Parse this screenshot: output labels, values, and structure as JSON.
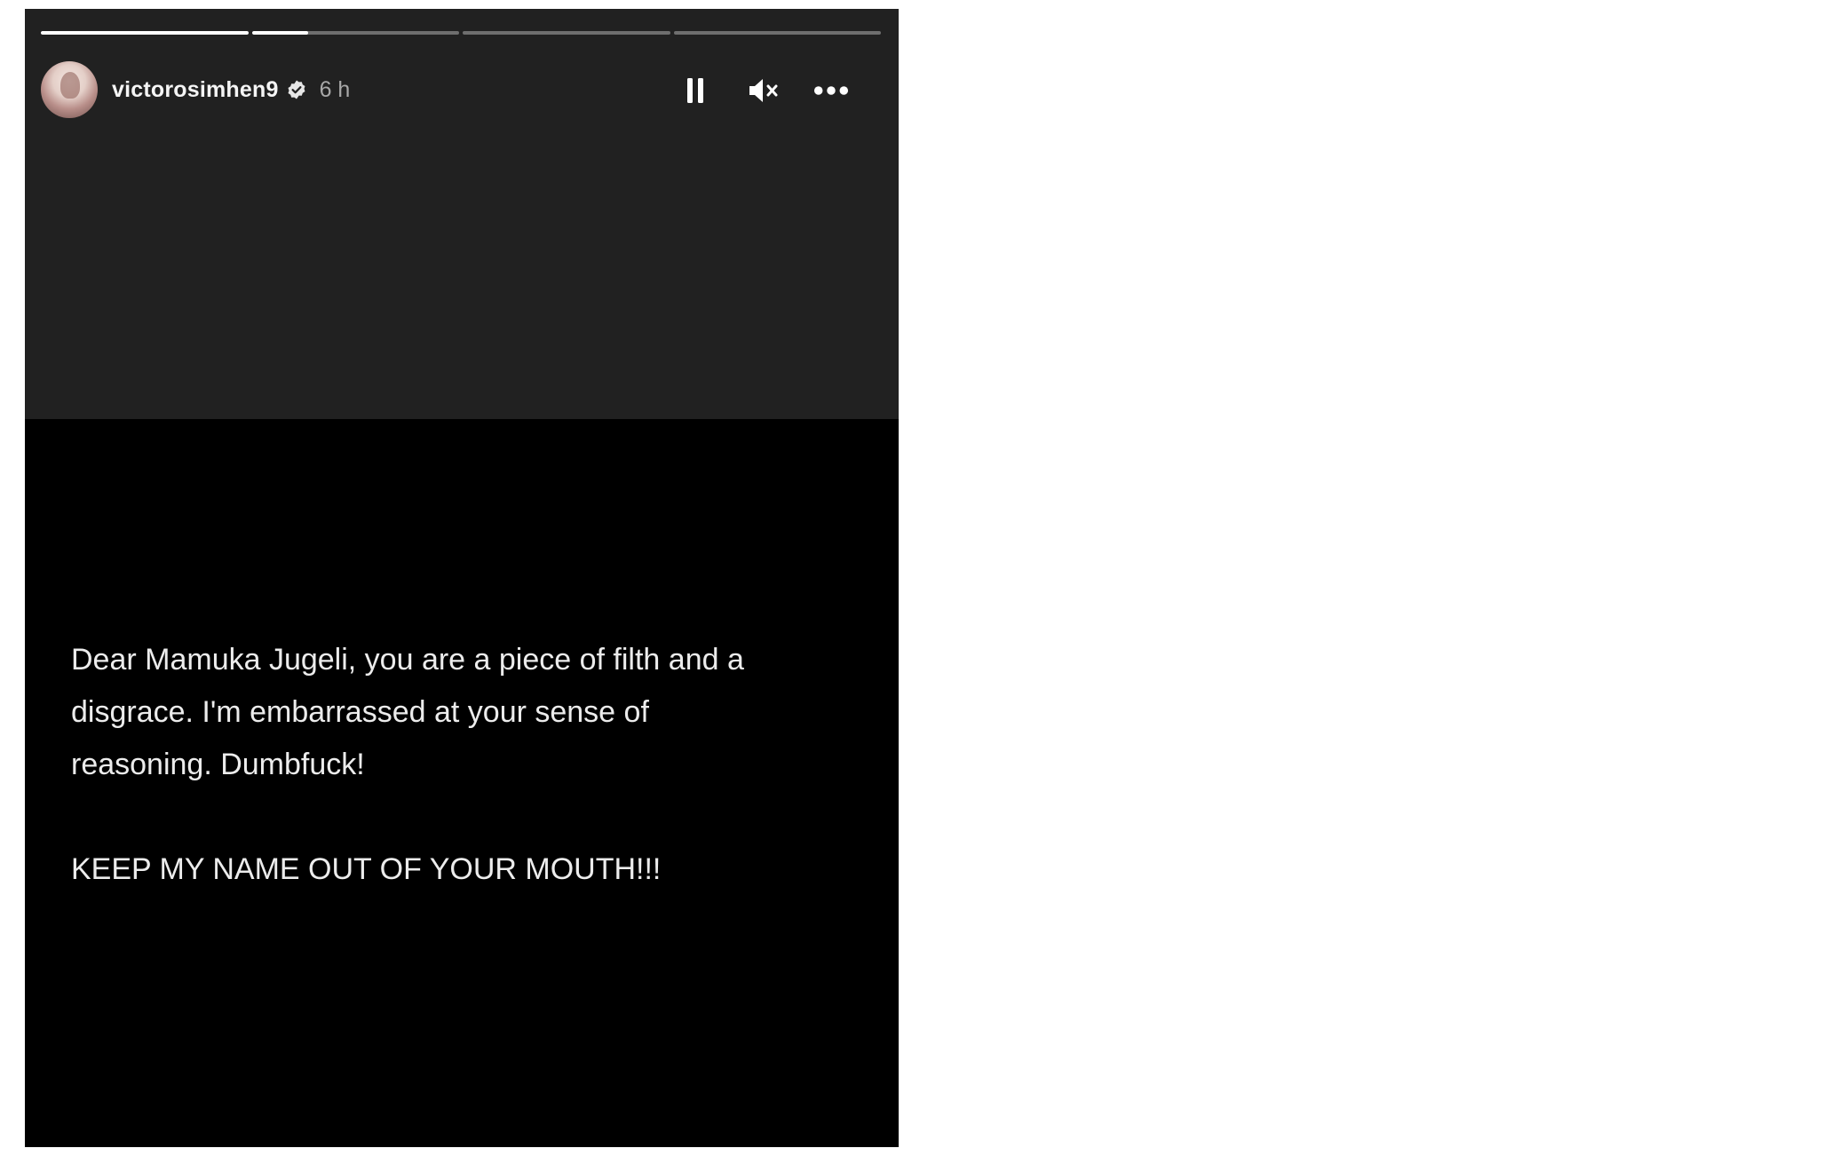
{
  "story": {
    "progress_segments": [
      {
        "fill": 1.0
      },
      {
        "fill": 0.27
      },
      {
        "fill": 0.0
      },
      {
        "fill": 0.0
      }
    ],
    "user": {
      "username": "victorosimhen9",
      "verified": true,
      "time": "6 h"
    },
    "controls": {
      "pause_icon": "pause-icon",
      "mute_icon": "speaker-muted-icon",
      "more_icon": "more-horizontal-icon"
    },
    "message": {
      "line1": "Dear Mamuka Jugeli, you are a piece of filth and a",
      "line2": "disgrace. I'm embarrassed at your sense of",
      "line3": "reasoning. Dumbfuck!",
      "line4": "KEEP MY NAME OUT OF YOUR MOUTH!!!"
    },
    "colors": {
      "top_background": "#212121",
      "bottom_background": "#000000",
      "text": "#ececec",
      "muted_text": "#a8a8a8"
    }
  }
}
